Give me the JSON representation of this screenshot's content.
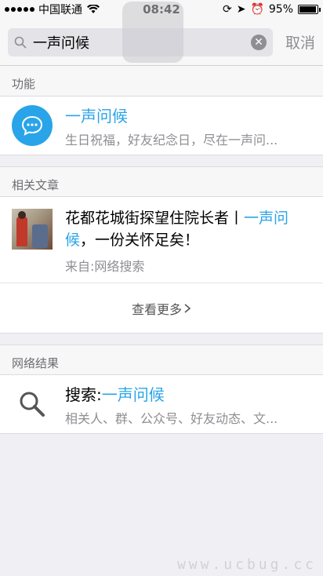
{
  "status_bar": {
    "carrier": "中国联通",
    "time": "08:42",
    "battery": "95%",
    "battery_level": 0.95
  },
  "search": {
    "query": "一声问候",
    "cancel_label": "取消"
  },
  "sections": {
    "function": {
      "header": "功能",
      "item_title": "一声问候",
      "item_sub": "生日祝福，好友纪念日，尽在一声问..."
    },
    "articles": {
      "header": "相关文章",
      "item_title_prefix": "花都花城街探望住院长者丨",
      "item_title_highlight": "一声问候",
      "item_title_suffix": "，一份关怀足矣！",
      "item_source": "来自:网络搜索",
      "more_label": "查看更多"
    },
    "web": {
      "header": "网络结果",
      "search_prefix": "搜索:",
      "search_term": "一声问候",
      "item_sub": "相关人、群、公众号、好友动态、文..."
    }
  },
  "watermark": "www.ucbug.cc",
  "colors": {
    "accent": "#2aa4e8",
    "secondary_text": "#8e8e93",
    "background": "#efeff4"
  }
}
